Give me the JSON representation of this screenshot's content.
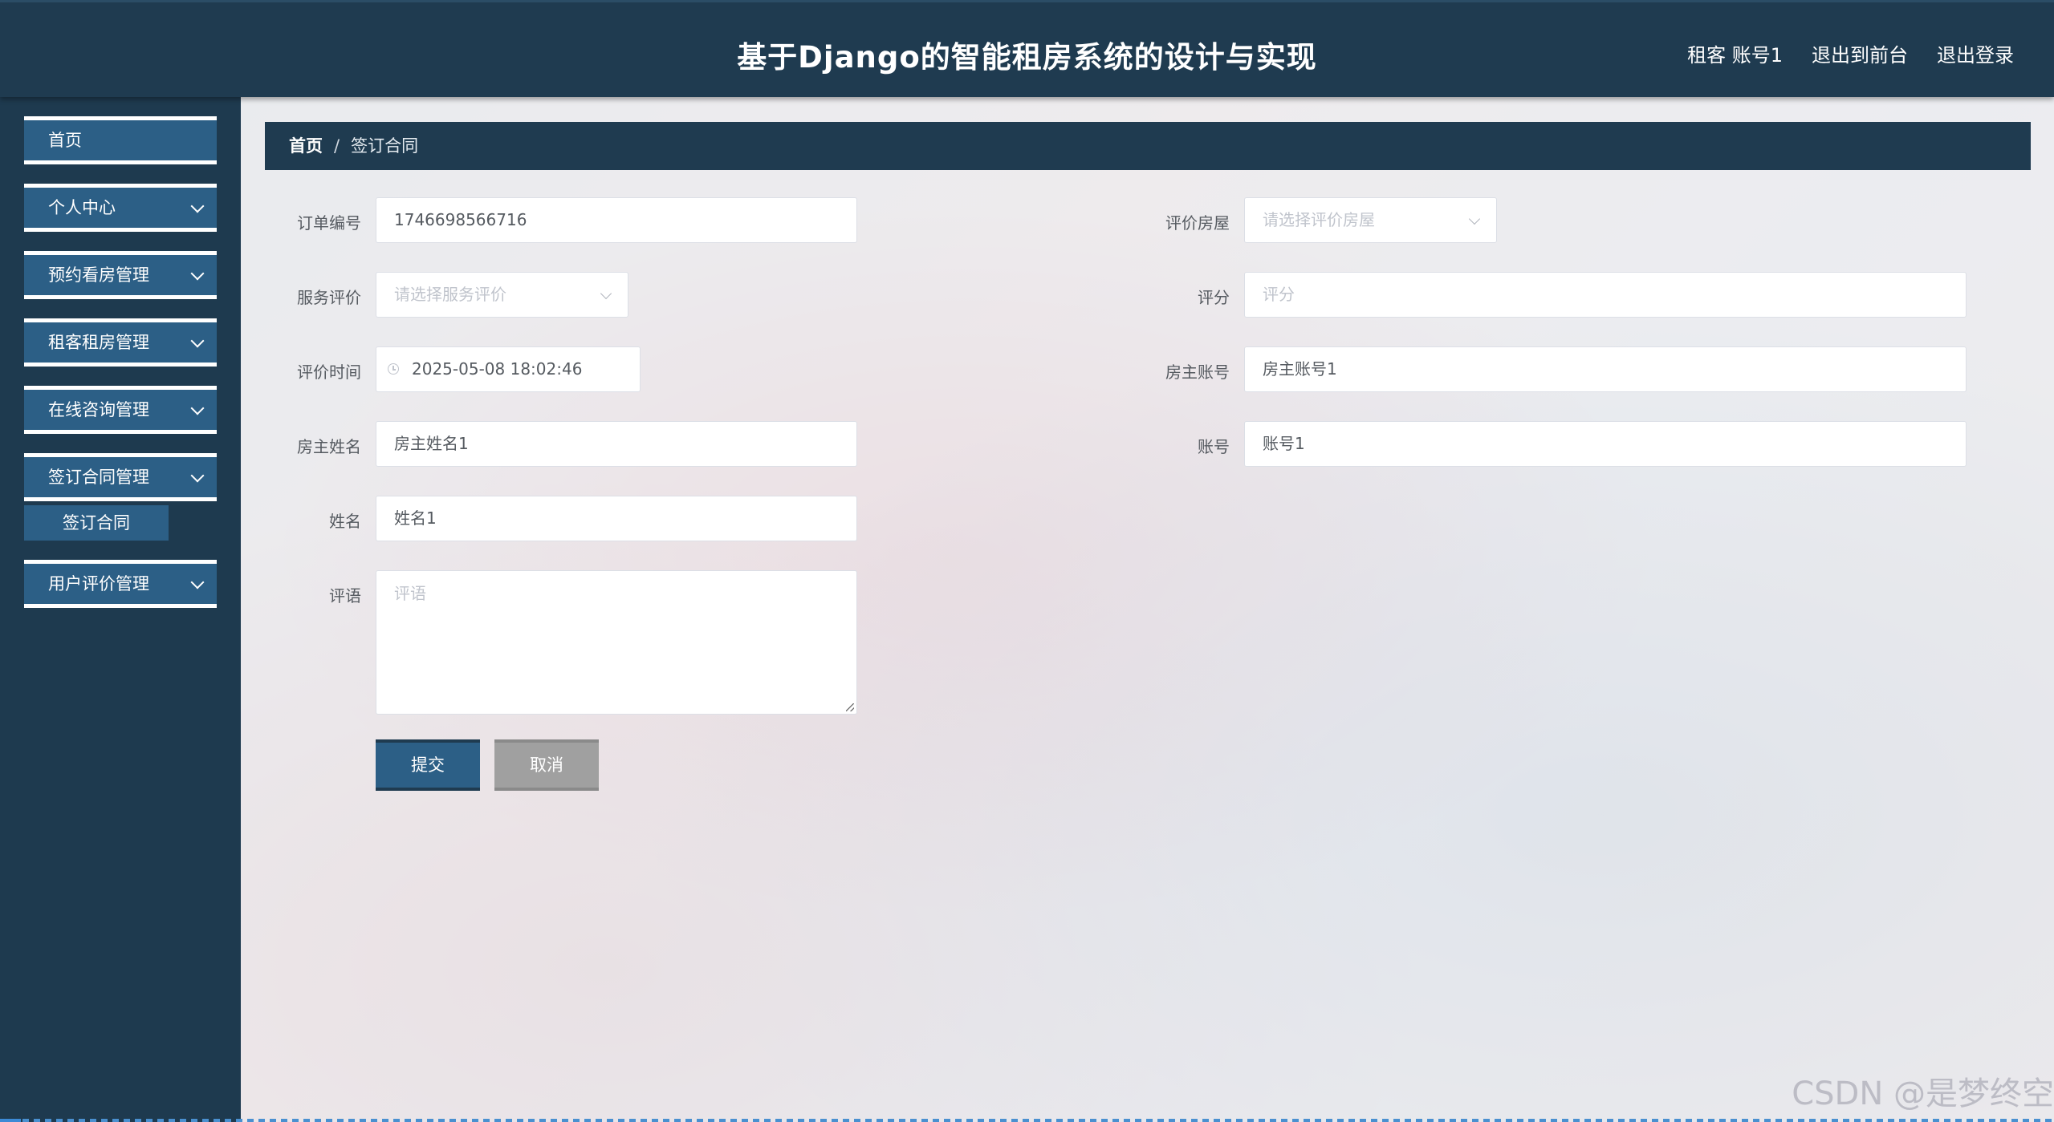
{
  "header": {
    "title": "基于Django的智能租房系统的设计与实现",
    "user_label": "租客 账号1",
    "to_frontend": "退出到前台",
    "logout": "退出登录"
  },
  "sidebar": {
    "items": [
      {
        "label": "首页"
      },
      {
        "label": "个人中心"
      },
      {
        "label": "预约看房管理"
      },
      {
        "label": "租客租房管理"
      },
      {
        "label": "在线咨询管理"
      },
      {
        "label": "签订合同管理"
      },
      {
        "label": "用户评价管理"
      }
    ],
    "submenu": {
      "label": "签订合同"
    }
  },
  "breadcrumb": {
    "home": "首页",
    "separator": "/",
    "current": "签订合同"
  },
  "form": {
    "order_no": {
      "label": "订单编号",
      "value": "1746698566716"
    },
    "review_house": {
      "label": "评价房屋",
      "placeholder": "请选择评价房屋"
    },
    "service_review": {
      "label": "服务评价",
      "placeholder": "请选择服务评价"
    },
    "score": {
      "label": "评分",
      "placeholder": "评分"
    },
    "review_time": {
      "label": "评价时间",
      "value": "2025-05-08 18:02:46"
    },
    "landlord_account": {
      "label": "房主账号",
      "value": "房主账号1"
    },
    "landlord_name": {
      "label": "房主姓名",
      "value": "房主姓名1"
    },
    "account": {
      "label": "账号",
      "value": "账号1"
    },
    "name": {
      "label": "姓名",
      "value": "姓名1"
    },
    "comment": {
      "label": "评语",
      "placeholder": "评语"
    }
  },
  "buttons": {
    "submit": "提交",
    "cancel": "取消"
  },
  "watermark": "CSDN @是梦终空",
  "colors": {
    "header_bg": "#1f3b50",
    "menu_bg": "#2c5f86",
    "cancel_bg": "#a0a0a0"
  }
}
